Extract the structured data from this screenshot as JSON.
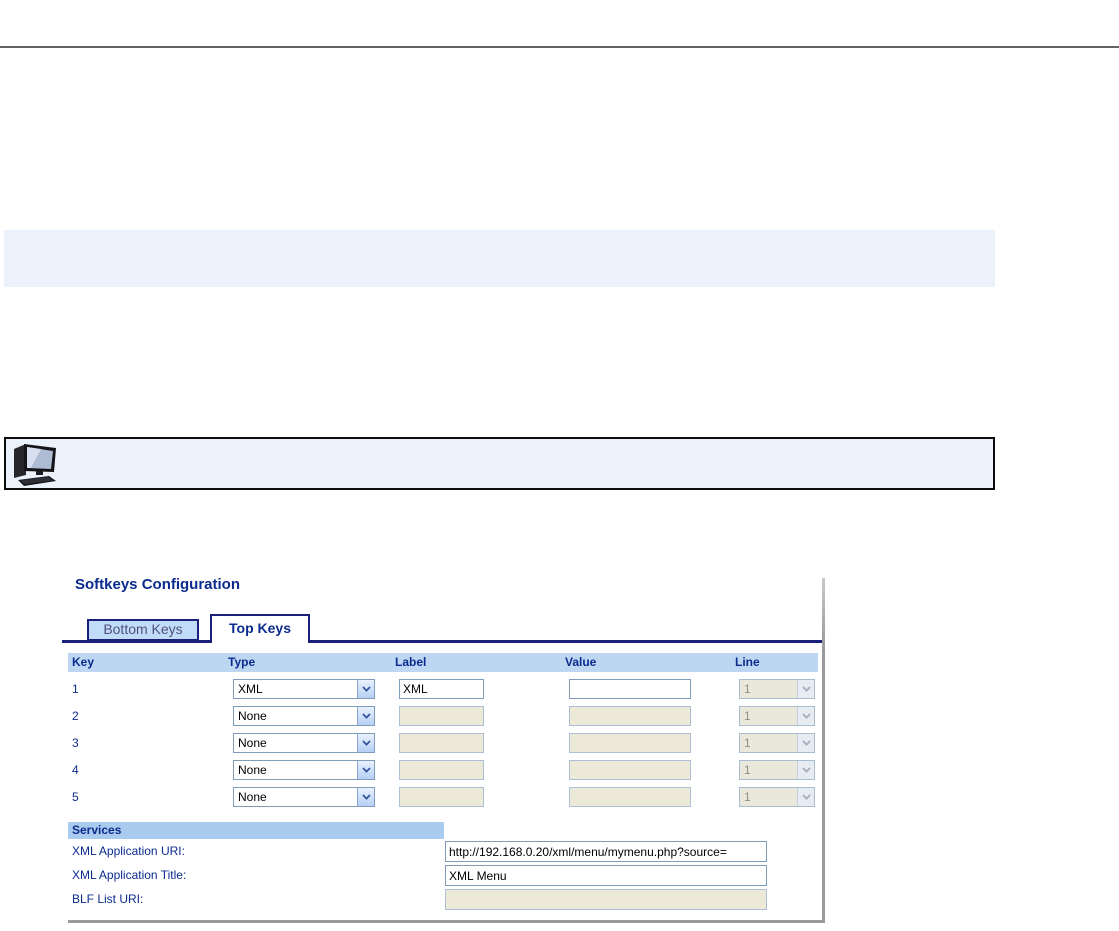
{
  "colors": {
    "navy_text": "#0b2b8e",
    "tab_border": "#1a1f7b",
    "table_header_bg": "#bdd7f2",
    "services_bar_bg": "#a9cbee",
    "note_box_bg": "#ecf2fb",
    "disabled_field_bg": "#ece9d8",
    "enabled_field_border": "#7f9db9",
    "inactive_tab_bg": "#c0dcf8"
  },
  "icons": {
    "computer_icon": "desktop-workstation"
  },
  "screenshot": {
    "title": "Softkeys Configuration",
    "tabs": [
      {
        "label": "Bottom Keys",
        "active": false
      },
      {
        "label": "Top Keys",
        "active": true
      }
    ],
    "table": {
      "headers": [
        "Key",
        "Type",
        "Label",
        "Value",
        "Line"
      ],
      "rows": [
        {
          "key": "1",
          "type": "XML",
          "label": "XML",
          "value": "",
          "line": "1",
          "type_enabled": true,
          "label_enabled": true,
          "value_enabled": true,
          "line_enabled": false
        },
        {
          "key": "2",
          "type": "None",
          "label": "",
          "value": "",
          "line": "1",
          "type_enabled": true,
          "label_enabled": false,
          "value_enabled": false,
          "line_enabled": false
        },
        {
          "key": "3",
          "type": "None",
          "label": "",
          "value": "",
          "line": "1",
          "type_enabled": true,
          "label_enabled": false,
          "value_enabled": false,
          "line_enabled": false
        },
        {
          "key": "4",
          "type": "None",
          "label": "",
          "value": "",
          "line": "1",
          "type_enabled": true,
          "label_enabled": false,
          "value_enabled": false,
          "line_enabled": false
        },
        {
          "key": "5",
          "type": "None",
          "label": "",
          "value": "",
          "line": "1",
          "type_enabled": true,
          "label_enabled": false,
          "value_enabled": false,
          "line_enabled": false
        }
      ]
    },
    "services": {
      "title": "Services",
      "fields": [
        {
          "label": "XML Application URI:",
          "value": "http://192.168.0.20/xml/menu/mymenu.php?source=",
          "enabled": true
        },
        {
          "label": "XML Application Title:",
          "value": "XML Menu",
          "enabled": true
        },
        {
          "label": "BLF List URI:",
          "value": "",
          "enabled": false
        }
      ]
    }
  }
}
